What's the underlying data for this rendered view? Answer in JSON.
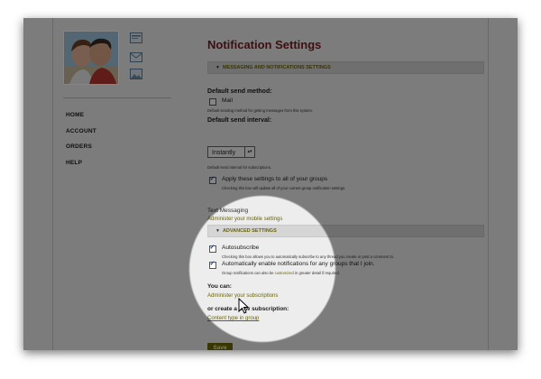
{
  "sidebar": {
    "nav": [
      "HOME",
      "ACCOUNT",
      "ORDERS",
      "HELP"
    ],
    "icons": [
      "id-card-icon",
      "mail-icon",
      "image-icon"
    ]
  },
  "main": {
    "title": "Notification Settings",
    "section1": "MESSAGING AND NOTIFICATIONS SETTINGS",
    "send_method_label": "Default send method:",
    "send_method_option": "Mail",
    "send_method_help": "Default sending method for getting messages from this system.",
    "interval_label": "Default send interval:",
    "interval_value": "Instantly",
    "interval_help": "Default send interval for subscriptions.",
    "apply_label": "Apply these settings to all of your groups",
    "apply_help": "Checking this box will update all of your current group notification settings.",
    "text_messaging": "Text Messaging",
    "mobile_link": "Administer your mobile settings",
    "section2": "ADVANCED SETTINGS",
    "autosubscribe_label": "Autosubscribe",
    "autosubscribe_help": "Checking this box allows you to automatically subscribe to any thread you create or post a comment to.",
    "auto_enable_label": "Automatically enable notifications for any groups that I join.",
    "auto_enable_help_pre": "Group notifications can also be",
    "auto_enable_help_link": "customized",
    "auto_enable_help_post": "in greater detail if required.",
    "you_can": "You can:",
    "admin_subs_link": "Administer your subscriptions",
    "create_new": "or create a new subscription:",
    "content_link": "Content type in group",
    "save": "Save"
  },
  "colors": {
    "title": "#7a1a22",
    "link": "#6b6500",
    "save_bg": "#6e6a00"
  }
}
